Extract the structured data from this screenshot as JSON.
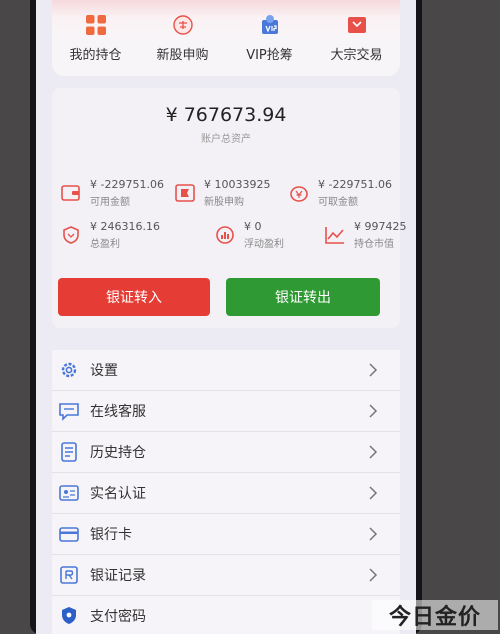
{
  "quick_nav": [
    {
      "label": "我的持仓",
      "icon": "grid-icon"
    },
    {
      "label": "新股申购",
      "icon": "stamp-icon"
    },
    {
      "label": "VIP抢筹",
      "icon": "vip-icon"
    },
    {
      "label": "大宗交易",
      "icon": "envelope-icon"
    }
  ],
  "account": {
    "total_assets": "¥ 767673.94",
    "total_assets_label": "账户总资产",
    "stats": [
      {
        "value": "¥ -229751.06",
        "label": "可用金额",
        "icon": "wallet-icon"
      },
      {
        "value": "¥ 10033925",
        "label": "新股申购",
        "icon": "flag-icon"
      },
      {
        "value": "¥ -229751.06",
        "label": "可取金额",
        "icon": "pot-icon"
      },
      {
        "value": "¥ 246316.16",
        "label": "总盈利",
        "icon": "shield-icon"
      },
      {
        "value": "¥ 0",
        "label": "浮动盈利",
        "icon": "stats-icon"
      },
      {
        "value": "¥ 997425",
        "label": "持仓市值",
        "icon": "trend-icon"
      }
    ],
    "transfer_in_label": "银证转入",
    "transfer_out_label": "银证转出"
  },
  "menu": [
    {
      "label": "设置",
      "icon": "gear-icon"
    },
    {
      "label": "在线客服",
      "icon": "chat-icon"
    },
    {
      "label": "历史持仓",
      "icon": "document-icon"
    },
    {
      "label": "实名认证",
      "icon": "id-card-icon"
    },
    {
      "label": "银行卡",
      "icon": "bank-card-icon"
    },
    {
      "label": "银证记录",
      "icon": "record-icon"
    },
    {
      "label": "支付密码",
      "icon": "shield-lock-icon"
    }
  ],
  "watermark": "今日金价",
  "colors": {
    "red": "#e53d36",
    "green": "#2f9a33",
    "icon_blue": "#4a78d8",
    "icon_red": "#e8514a"
  }
}
